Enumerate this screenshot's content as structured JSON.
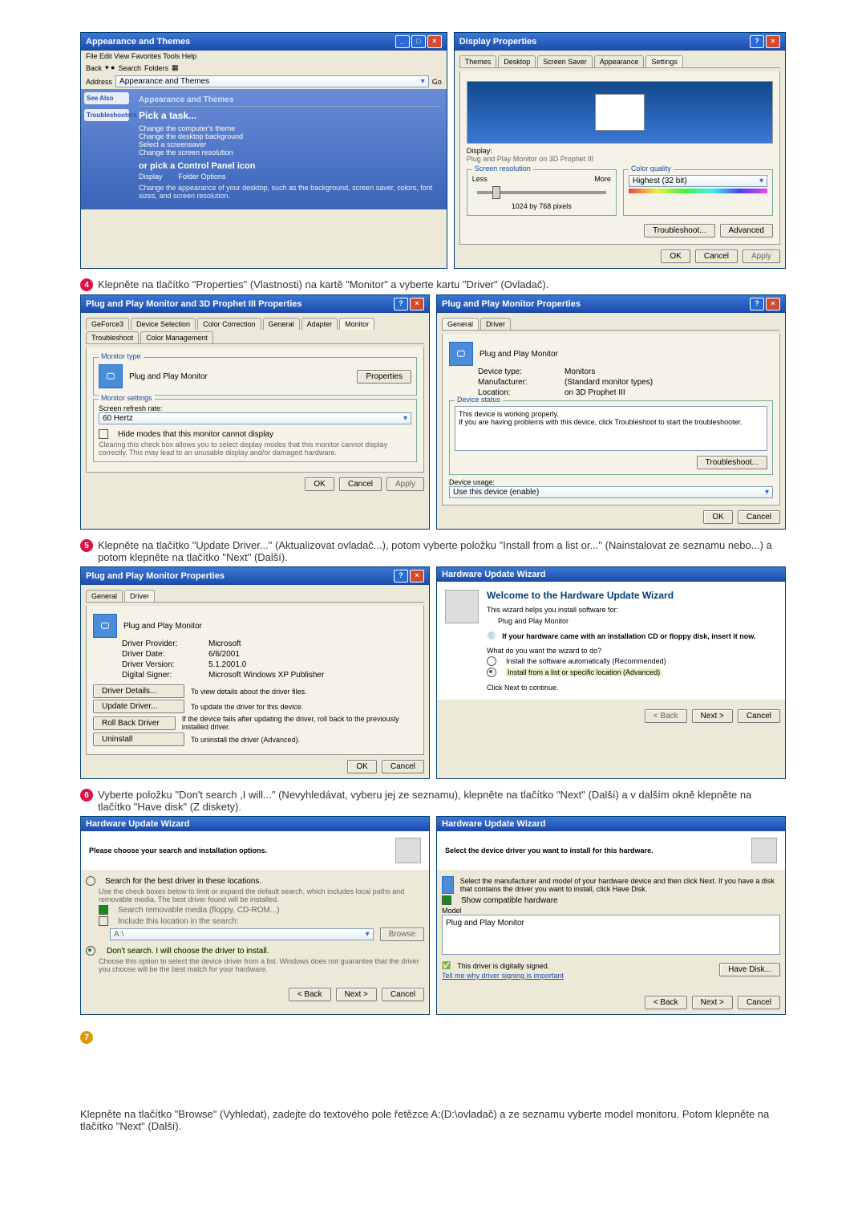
{
  "step4_text": "Klepněte na tlačítko \"Properties\" (Vlastnosti) na kartě \"Monitor\" a vyberte kartu \"Driver\" (Ovladač).",
  "step5_text": "Klepněte na tlačítko \"Update Driver...\" (Aktualizovat ovladač...), potom vyberte položku \"Install from a list or...\" (Nainstalovat ze seznamu nebo...) a potom klepněte na tlačítko \"Next\" (Další).",
  "step6_text": "Vyberte položku \"Don't search ,I will...\" (Nevyhledávat, vyberu jej ze seznamu), klepněte na tlačítko \"Next\" (Další) a v dalším okně klepněte na tlačítko \"Have disk\" (Z diskety).",
  "step7_text": "Klepněte na tlačítko \"Browse\" (Vyhledat), zadejte do textového pole řetězce A:(D:\\ovladač) a ze seznamu vyberte model monitoru. Potom klepněte na tlačítko \"Next\" (Další).",
  "bullets": {
    "b4": "4",
    "b5": "5",
    "b6": "6",
    "b7": "7"
  },
  "explorer": {
    "title": "Appearance and Themes",
    "menu": "File  Edit  View  Favorites  Tools  Help",
    "back": "Back",
    "search": "Search",
    "folders": "Folders",
    "addr": "Address",
    "addr_val": "Appearance and Themes",
    "go": "Go",
    "section": "Appearance and Themes",
    "pick": "Pick a task...",
    "task1": "Change the computer's theme",
    "task2": "Change the desktop background",
    "task3": "Select a screensaver",
    "task4": "Change the screen resolution",
    "or": "or pick a Control Panel icon",
    "cp1": "Display",
    "cp2": "Folder Options",
    "cp_task": "Change the appearance of your desktop, such as the background, screen saver, colors, font sizes, and screen resolution.",
    "see": "See Also",
    "trouble": "Troubleshooters"
  },
  "display": {
    "title": "Display Properties",
    "tabs": [
      "Themes",
      "Desktop",
      "Screen Saver",
      "Appearance",
      "Settings"
    ],
    "disp": "Display:",
    "disp_val": "Plug and Play Monitor on 3D Prophet III",
    "res": "Screen resolution",
    "less": "Less",
    "more": "More",
    "res_val": "1024 by 768 pixels",
    "quality": "Color quality",
    "quality_val": "Highest (32 bit)",
    "trouble": "Troubleshoot...",
    "adv": "Advanced",
    "ok": "OK",
    "cancel": "Cancel",
    "apply": "Apply"
  },
  "prop3d": {
    "title": "Plug and Play Monitor and 3D Prophet III Properties",
    "tabs": [
      "GeForce3",
      "Device Selection",
      "Color Correction",
      "General",
      "Adapter",
      "Monitor",
      "Troubleshoot",
      "Color Management"
    ],
    "mt": "Monitor type",
    "mt_val": "Plug and Play Monitor",
    "prop": "Properties",
    "ms": "Monitor settings",
    "refresh": "Screen refresh rate:",
    "refresh_val": "60 Hertz",
    "hide": "Hide modes that this monitor cannot display",
    "hide_desc": "Clearing this check box allows you to select display modes that this monitor cannot display correctly. This may lead to an unusable display and/or damaged hardware.",
    "ok": "OK",
    "cancel": "Cancel",
    "apply": "Apply"
  },
  "monprop": {
    "title": "Plug and Play Monitor Properties",
    "tabs": [
      "General",
      "Driver"
    ],
    "name": "Plug and Play Monitor",
    "dtype": "Device type:",
    "dtype_v": "Monitors",
    "mfr": "Manufacturer:",
    "mfr_v": "(Standard monitor types)",
    "loc": "Location:",
    "loc_v": "on 3D Prophet III",
    "status": "Device status",
    "status_v": "This device is working properly.",
    "status_help": "If you are having problems with this device, click Troubleshoot to start the troubleshooter.",
    "ts": "Troubleshoot...",
    "usage": "Device usage:",
    "usage_v": "Use this device (enable)",
    "ok": "OK",
    "cancel": "Cancel"
  },
  "monprop2": {
    "title": "Plug and Play Monitor Properties",
    "tabs": [
      "General",
      "Driver"
    ],
    "name": "Plug and Play Monitor",
    "dp": "Driver Provider:",
    "dp_v": "Microsoft",
    "dd": "Driver Date:",
    "dd_v": "6/6/2001",
    "dv": "Driver Version:",
    "dv_v": "5.1.2001.0",
    "ds": "Digital Signer:",
    "ds_v": "Microsoft Windows XP Publisher",
    "details": "Driver Details...",
    "details_d": "To view details about the driver files.",
    "update": "Update Driver...",
    "update_d": "To update the driver for this device.",
    "rollback": "Roll Back Driver",
    "rollback_d": "If the device fails after updating the driver, roll back to the previously installed driver.",
    "uninstall": "Uninstall",
    "uninstall_d": "To uninstall the driver (Advanced).",
    "ok": "OK",
    "cancel": "Cancel"
  },
  "wiz1": {
    "title": "Hardware Update Wizard",
    "welcome": "Welcome to the Hardware Update Wizard",
    "desc": "This wizard helps you install software for:",
    "dev": "Plug and Play Monitor",
    "cd": "If your hardware came with an installation CD or floppy disk, insert it now.",
    "what": "What do you want the wizard to do?",
    "opt1": "Install the software automatically (Recommended)",
    "opt2": "Install from a list or specific location (Advanced)",
    "click": "Click Next to continue.",
    "back": "< Back",
    "next": "Next >",
    "cancel": "Cancel"
  },
  "wiz2": {
    "title": "Hardware Update Wizard",
    "head": "Please choose your search and installation options.",
    "opt1": "Search for the best driver in these locations.",
    "opt1d": "Use the check boxes below to limit or expand the default search, which includes local paths and removable media. The best driver found will be installed.",
    "ck1": "Search removable media (floppy, CD-ROM...)",
    "ck2": "Include this location in the search:",
    "path": "A:\\",
    "browse": "Browse",
    "opt2": "Don't search. I will choose the driver to install.",
    "opt2d": "Choose this option to select the device driver from a list. Windows does not guarantee that the driver you choose will be the best match for your hardware.",
    "back": "< Back",
    "next": "Next >",
    "cancel": "Cancel"
  },
  "wiz3": {
    "title": "Hardware Update Wizard",
    "head": "Select the device driver you want to install for this hardware.",
    "desc": "Select the manufacturer and model of your hardware device and then click Next. If you have a disk that contains the driver you want to install, click Have Disk.",
    "compat": "Show compatible hardware",
    "model": "Model",
    "item": "Plug and Play Monitor",
    "signed": "This driver is digitally signed.",
    "tell": "Tell me why driver signing is important",
    "have": "Have Disk...",
    "back": "< Back",
    "next": "Next >",
    "cancel": "Cancel"
  }
}
